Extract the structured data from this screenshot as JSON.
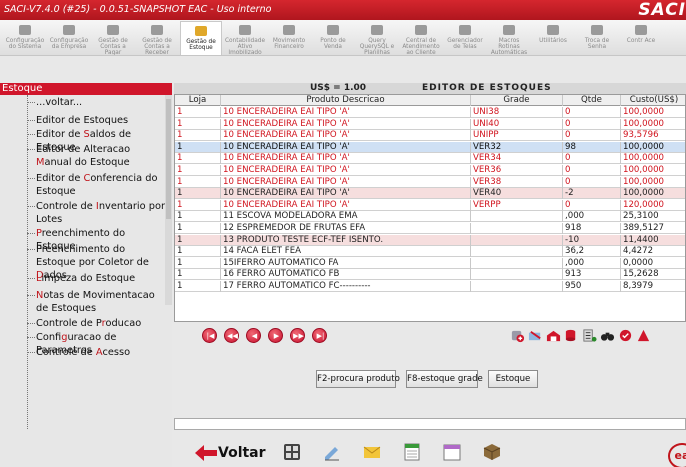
{
  "window": {
    "title": "SACI-V7.4.0 (#25) - 0.0.51-SNAPSHOT  EAC - Uso interno",
    "brand": "SACI"
  },
  "toolbar": {
    "items": [
      {
        "label": "Configuração do Sistema",
        "icon": "config-icon"
      },
      {
        "label": "Configuração da Empresa",
        "icon": "building-icon"
      },
      {
        "label": "Gestão de Contas a Pagar",
        "icon": "pay-icon"
      },
      {
        "label": "Gestão de Contas a Receber",
        "icon": "receive-icon"
      },
      {
        "label": "Gestão de Estoque",
        "icon": "stock-icon",
        "active": true
      },
      {
        "label": "Contabilidade Ativo Imobilizado",
        "icon": "asset-icon"
      },
      {
        "label": "Movimento Financeiro",
        "icon": "finance-icon"
      },
      {
        "label": "Ponto de Venda",
        "icon": "pos-icon"
      },
      {
        "label": "Query QuerySQL e Planilhas",
        "icon": "query-icon"
      },
      {
        "label": "Central de Atendimento ao Cliente",
        "icon": "support-icon"
      },
      {
        "label": "Gerenciador de Telas",
        "icon": "screens-icon"
      },
      {
        "label": "Macros Rotinas Automáticas",
        "icon": "macro-icon"
      },
      {
        "label": "Utilitários",
        "icon": "tools-icon"
      },
      {
        "label": "Troca de Senha",
        "icon": "password-icon"
      },
      {
        "label": "Contr Ace",
        "icon": "access-icon"
      }
    ]
  },
  "tree": {
    "header": "Estoque",
    "items": [
      {
        "pre": "...",
        "hl": "",
        "post": "voltar..."
      },
      {
        "pre": "Editor de Estoques",
        "hl": "",
        "post": ""
      },
      {
        "pre": "Editor de ",
        "hl": "S",
        "post": "aldos de Estoque"
      },
      {
        "pre": "Editor de Alteracao ",
        "hl": "M",
        "post": "anual do Estoque"
      },
      {
        "pre": "Editor de ",
        "hl": "C",
        "post": "onferencia do Estoque"
      },
      {
        "pre": "Controle de ",
        "hl": "I",
        "post": "nventario por Lotes"
      },
      {
        "pre": "",
        "hl": "P",
        "post": "reenchimento do Estoque"
      },
      {
        "pre": "Preenchimento do Estoque por Coletor de ",
        "hl": "D",
        "post": "ados"
      },
      {
        "pre": "",
        "hl": "L",
        "post": "impeza do Estoque"
      },
      {
        "pre": "",
        "hl": "N",
        "post": "otas de Movimentacao de Estoques"
      },
      {
        "pre": "Controle de P",
        "hl": "r",
        "post": "oducao"
      },
      {
        "pre": "Confi",
        "hl": "g",
        "post": "uracao de Parametros"
      },
      {
        "pre": "Controle de ",
        "hl": "A",
        "post": "cesso"
      }
    ]
  },
  "main": {
    "rate": "US$ = 1.00",
    "title": "EDITOR DE ESTOQUES",
    "columns": [
      "Loja",
      "Produto Descricao",
      "Grade",
      "Qtde",
      "Custo(US$)"
    ],
    "rows": [
      {
        "loja": "1",
        "produto": "10 ENCERADEIRA EAI TIPO 'A'",
        "grade": "UNI38",
        "qtde": "0",
        "custo": "100,0000",
        "style": "red"
      },
      {
        "loja": "1",
        "produto": "10 ENCERADEIRA EAI TIPO 'A'",
        "grade": "UNI40",
        "qtde": "0",
        "custo": "100,0000",
        "style": "red"
      },
      {
        "loja": "1",
        "produto": "10 ENCERADEIRA EAI TIPO 'A'",
        "grade": "UNIPP",
        "qtde": "0",
        "custo": "93,5796",
        "style": "red"
      },
      {
        "loja": "1",
        "produto": "10 ENCERADEIRA EAI TIPO 'A'",
        "grade": "VER32",
        "qtde": "98",
        "custo": "100,0000",
        "style": "sel"
      },
      {
        "loja": "1",
        "produto": "10 ENCERADEIRA EAI TIPO 'A'",
        "grade": "VER34",
        "qtde": "0",
        "custo": "100,0000",
        "style": "red"
      },
      {
        "loja": "1",
        "produto": "10 ENCERADEIRA EAI TIPO 'A'",
        "grade": "VER36",
        "qtde": "0",
        "custo": "100,0000",
        "style": "red"
      },
      {
        "loja": "1",
        "produto": "10 ENCERADEIRA EAI TIPO 'A'",
        "grade": "VER38",
        "qtde": "0",
        "custo": "100,0000",
        "style": "red"
      },
      {
        "loja": "1",
        "produto": "10 ENCERADEIRA EAI TIPO 'A'",
        "grade": "VER40",
        "qtde": "-2",
        "custo": "100,0000",
        "style": "pink"
      },
      {
        "loja": "1",
        "produto": "10 ENCERADEIRA EAI TIPO 'A'",
        "grade": "VERPP",
        "qtde": "0",
        "custo": "120,0000",
        "style": "red"
      },
      {
        "loja": "1",
        "produto": "11 ESCOVA MODELADORA EMA",
        "grade": "",
        "qtde": ",000",
        "custo": "25,3100",
        "style": ""
      },
      {
        "loja": "1",
        "produto": "12 ESPREMEDOR DE FRUTAS EFA",
        "grade": "",
        "qtde": "918",
        "custo": "389,5127",
        "style": ""
      },
      {
        "loja": "1",
        "produto": "13 PRODUTO TESTE ECF-TEF ISENTO.",
        "grade": "",
        "qtde": "-10",
        "custo": "11,4400",
        "style": "pink"
      },
      {
        "loja": "1",
        "produto": "14 FACA ELET FEA",
        "grade": "",
        "qtde": "36,2",
        "custo": "4,4272",
        "style": ""
      },
      {
        "loja": "1",
        "produto": "15IFERRO AUTOMATICO FA",
        "grade": "",
        "qtde": ",000",
        "custo": "0,0000",
        "style": ""
      },
      {
        "loja": "1",
        "produto": "16 FERRO AUTOMATICO FB",
        "grade": "",
        "qtde": "913",
        "custo": "15,2628",
        "style": ""
      },
      {
        "loja": "1",
        "produto": "17 FERRO AUTOMATICO FC----------",
        "grade": "",
        "qtde": "950",
        "custo": "8,3979",
        "style": ""
      }
    ],
    "nav": [
      "first",
      "prev-page",
      "prev",
      "next",
      "next-page",
      "last"
    ],
    "buttons": {
      "procura": "F2-procura produto",
      "estoque_grade": "F8-estoque grade",
      "estoque": "Estoque"
    }
  },
  "bottom": {
    "voltar": "Voltar",
    "logo": "ea"
  },
  "colors": {
    "accent": "#c8102e",
    "selected_row": "#cfe0f4",
    "negative_row": "#f6dede"
  }
}
